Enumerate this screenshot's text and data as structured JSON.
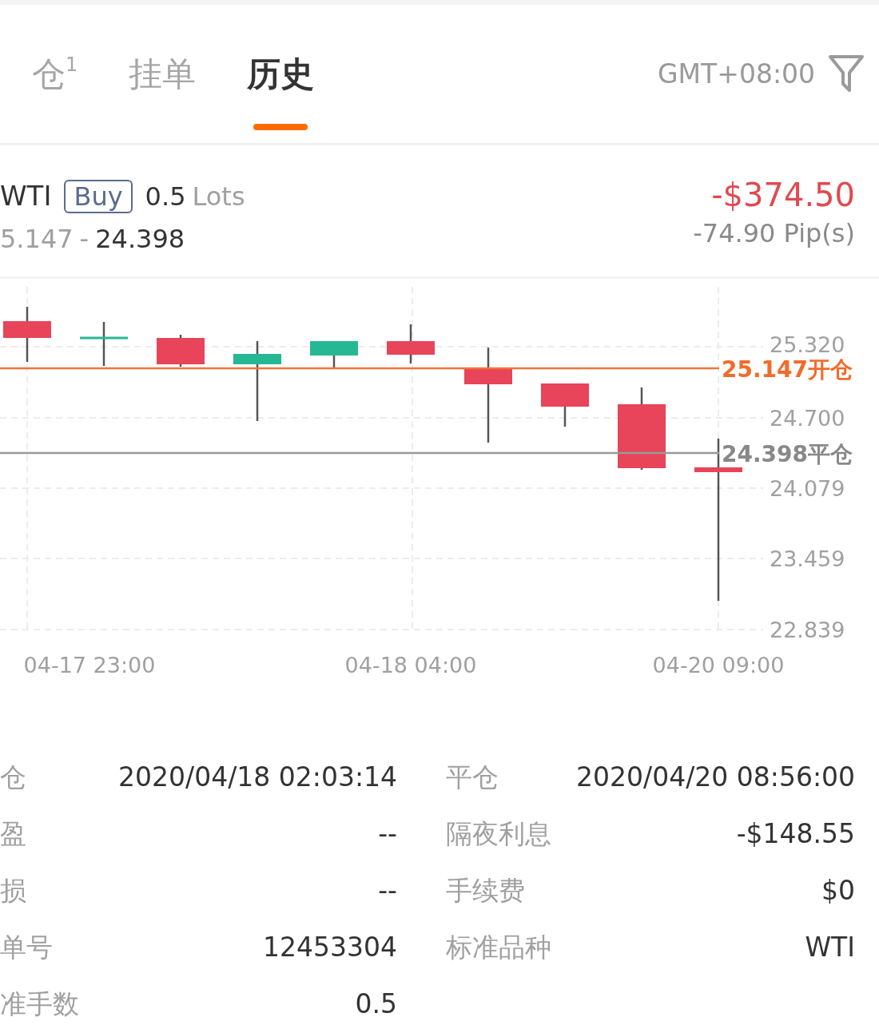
{
  "tabs": [
    {
      "label": "仓$^{1}$",
      "selected": false
    },
    {
      "label": "挂单",
      "selected": false
    },
    {
      "label": "历史",
      "selected": true
    }
  ],
  "timezone": "GMT+08:00",
  "order": {
    "symbol": "WTI",
    "side": "Buy",
    "volume": "0.5",
    "unit": "Lots",
    "open_price": "5.147",
    "separator": "-",
    "close_price": "24.398",
    "profit": "-$374.50",
    "pips": "-74.90 Pip(s)"
  },
  "chart": {
    "yticks": [
      "25.320",
      "24.700",
      "24.079",
      "23.459",
      "22.839"
    ],
    "xticks": [
      "04-17 23:00",
      "04-18 04:00",
      "04-20 09:00"
    ],
    "lines": [
      {
        "kind": "open",
        "label": "25.147开仓"
      },
      {
        "kind": "close",
        "label": "24.398平仓"
      }
    ],
    "candles": [
      {
        "kind": "down"
      },
      {
        "kind": "up"
      },
      {
        "kind": "down"
      },
      {
        "kind": "up"
      },
      {
        "kind": "up"
      },
      {
        "kind": "down"
      },
      {
        "kind": "down"
      },
      {
        "kind": "down"
      },
      {
        "kind": "down"
      },
      {
        "kind": "down"
      }
    ]
  },
  "details": [
    {
      "left": {
        "label": "仓",
        "value": "2020/04/18 02:03:14"
      },
      "right": {
        "label": "平仓",
        "value": "2020/04/20 08:56:00"
      }
    },
    {
      "left": {
        "label": "盈",
        "value": "--"
      },
      "right": {
        "label": "隔夜利息",
        "value": "-$148.55"
      }
    },
    {
      "left": {
        "label": "损",
        "value": "--"
      },
      "right": {
        "label": "手续费",
        "value": "$0"
      }
    },
    {
      "left": {
        "label": "单号",
        "value": "12453304"
      },
      "right": {
        "label": "标准品种",
        "value": "WTI"
      }
    },
    {
      "left": {
        "label": "准手数",
        "value": "0.5"
      }
    }
  ]
}
